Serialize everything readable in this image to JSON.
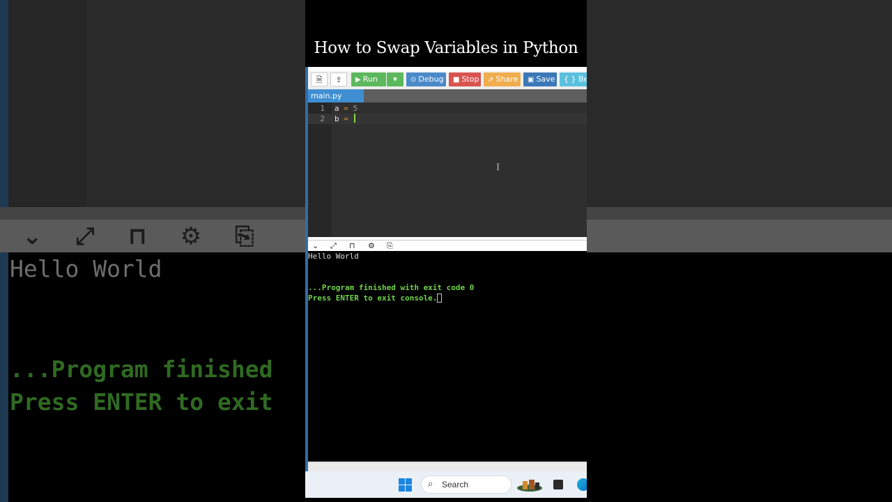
{
  "title": "How to Swap Variables in Python",
  "toolbar": {
    "run": "Run",
    "debug": "Debug",
    "stop": "Stop",
    "share": "Share",
    "save": "Save",
    "beautify": "{ } Bea"
  },
  "editor": {
    "tab": "main.py",
    "lines": [
      {
        "num": "1",
        "var": "a",
        "op": "=",
        "val": "5"
      },
      {
        "num": "2",
        "var": "b",
        "op": "=",
        "val": ""
      }
    ]
  },
  "console": {
    "output": "Hello World",
    "finished": "...Program finished with exit code 0",
    "prompt": "Press ENTER to exit console."
  },
  "backdrop": {
    "output": "Hello World",
    "finished": "...Program finished",
    "prompt": "Press ENTER to exit"
  },
  "taskbar": {
    "search": "Search"
  },
  "colors": {
    "run": "#5cb85c",
    "debug": "#4a8ac9",
    "stop": "#d9534f",
    "share": "#f0ad4e",
    "save": "#3a78b8",
    "console_green": "#6fd34a"
  }
}
